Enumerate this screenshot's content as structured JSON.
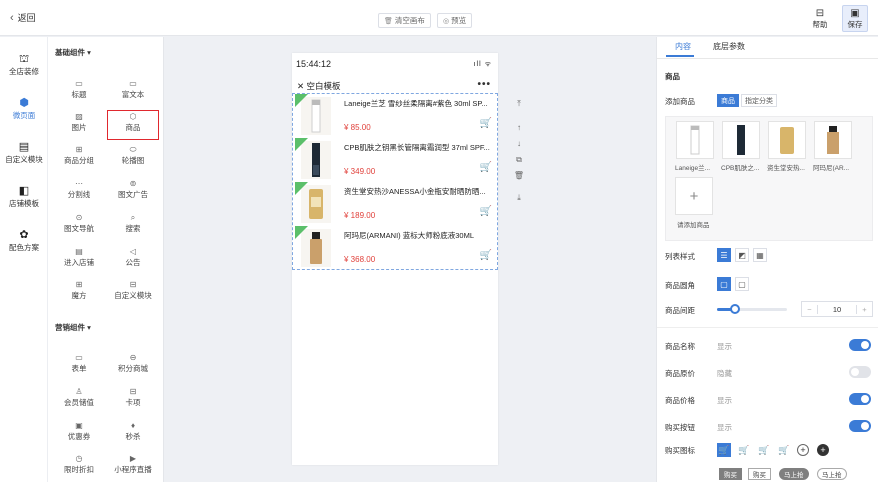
{
  "header": {
    "back_label": "返回",
    "clear_label": "清空画布",
    "preview_label": "预览",
    "help_label": "帮助",
    "save_label": "保存"
  },
  "leftnav": {
    "items": [
      {
        "label": "全店装修",
        "icon": "paint-roller-icon"
      },
      {
        "label": "微页面",
        "icon": "cube-icon",
        "active": true
      },
      {
        "label": "自定义模块",
        "icon": "module-icon"
      },
      {
        "label": "店铺模板",
        "icon": "template-icon"
      },
      {
        "label": "配色方案",
        "icon": "palette-icon"
      }
    ]
  },
  "components": {
    "basic_title": "基础组件",
    "basic": [
      "标题",
      "富文本",
      "图片",
      "商品",
      "商品分组",
      "轮播图",
      "分割线",
      "图文广告",
      "图文导航",
      "搜索",
      "进入店铺",
      "公告",
      "魔方",
      "自定义模块"
    ],
    "selected": "商品",
    "marketing_title": "营销组件",
    "marketing": [
      "表单",
      "积分商城",
      "会员储值",
      "卡项",
      "优惠券",
      "秒杀",
      "限时折扣",
      "小程序直播"
    ]
  },
  "phone": {
    "time": "15:44:12",
    "signal": "ıll ᯤ",
    "nav_title": "空白模板",
    "products": [
      {
        "title": "Laneige兰芝 雪纱丝柔隔离#紫色 30ml SP...",
        "price": "¥ 85.00"
      },
      {
        "title": "CPB肌肤之钥黑长管隔离霜润型 37ml SPF...",
        "price": "¥ 349.00"
      },
      {
        "title": "资生堂安热沙ANESSA小金瓶安耐晒防晒...",
        "price": "¥ 189.00"
      },
      {
        "title": "阿玛尼(ARMANI) 蓝标大师粉底液30ML",
        "price": "¥ 368.00"
      }
    ]
  },
  "panel": {
    "tabs": [
      "内容",
      "底层参数"
    ],
    "section_title": "商品",
    "add_goods_label": "添加商品",
    "add_goods_options": [
      "商品",
      "指定分类"
    ],
    "goods": [
      "Laneige兰...",
      "CPB肌肤之...",
      "资生堂安热...",
      "阿玛尼(AR..."
    ],
    "add_button_label": "请添加商品",
    "list_style_label": "列表样式",
    "corner_label": "商品圆角",
    "spacing_label": "商品间距",
    "spacing_value": "10",
    "spacing_slider_fraction": 0.25,
    "toggles": [
      {
        "label": "商品名称",
        "status": "显示",
        "on": true
      },
      {
        "label": "商品原价",
        "status": "隐藏",
        "on": false
      },
      {
        "label": "商品价格",
        "status": "显示",
        "on": true
      },
      {
        "label": "购买按钮",
        "status": "显示",
        "on": true
      }
    ],
    "buy_icon_label": "购买图标",
    "buy_buttons": [
      "购买",
      "购买",
      "马上抢",
      "马上抢"
    ]
  },
  "colors": {
    "accent": "#3b7bd6",
    "price": "#e0403a",
    "badge": "#5bbf6a",
    "selected_outline": "#e0282e"
  }
}
